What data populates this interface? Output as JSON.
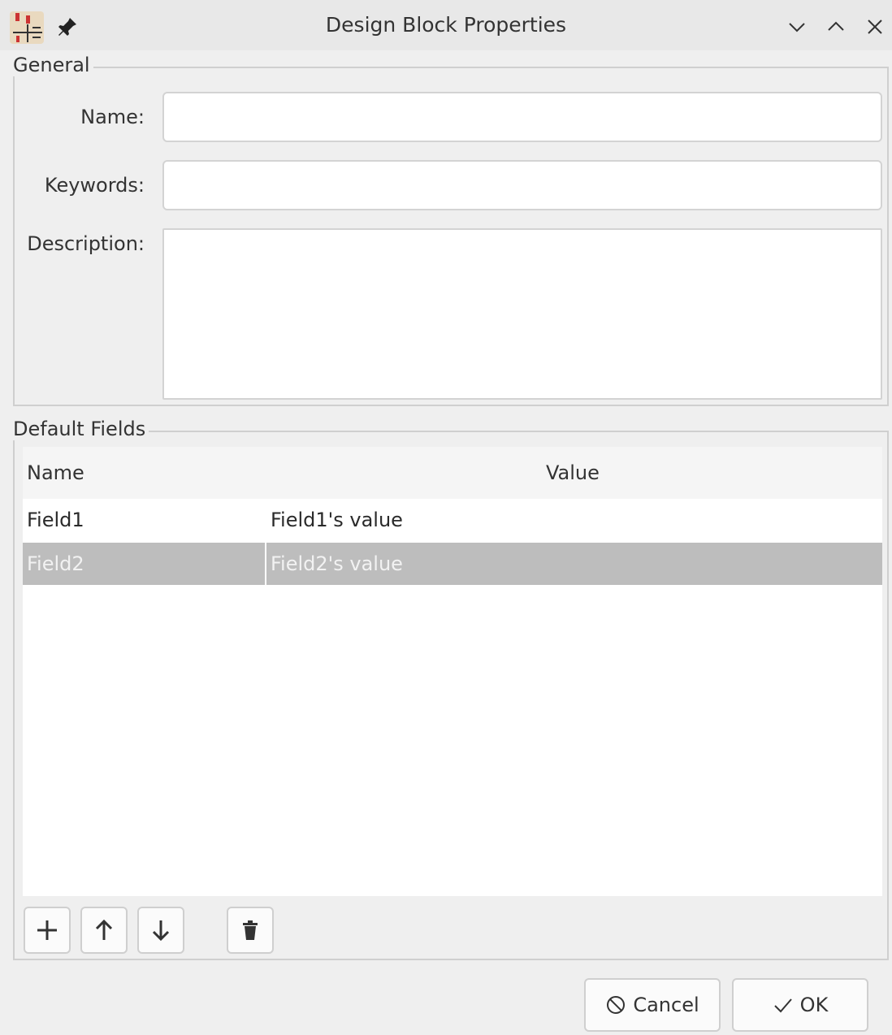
{
  "window": {
    "title": "Design Block Properties",
    "icons": {
      "app": "kicad-design-block-icon",
      "pin": "pin-icon",
      "minimize": "chevron-down-icon",
      "maximize": "chevron-up-icon",
      "close": "close-icon"
    }
  },
  "general": {
    "group_label": "General",
    "name_label": "Name:",
    "name_value": "",
    "keywords_label": "Keywords:",
    "keywords_value": "",
    "description_label": "Description:",
    "description_value": ""
  },
  "default_fields": {
    "group_label": "Default Fields",
    "columns": [
      "Name",
      "Value"
    ],
    "rows": [
      {
        "name": "Field1",
        "value": "Field1's value",
        "selected": false
      },
      {
        "name": "Field2",
        "value": "Field2's value",
        "selected": true
      }
    ],
    "tool_buttons": [
      "add-icon",
      "move-up-icon",
      "move-down-icon",
      "delete-icon"
    ]
  },
  "buttons": {
    "cancel": "Cancel",
    "ok": "OK"
  },
  "colors": {
    "selected_row": "#bdbdbd",
    "background": "#efefef",
    "accent_red": "#d23a3a"
  }
}
